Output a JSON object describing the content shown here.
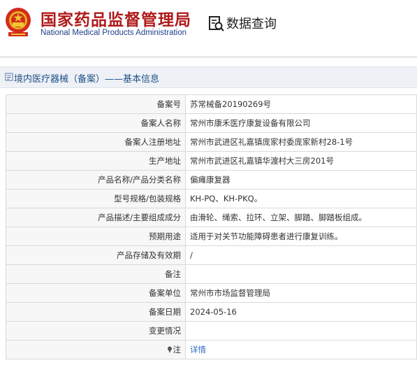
{
  "header": {
    "title_cn": "国家药品监督管理局",
    "title_en": "National Medical Products Administration",
    "search_label": "数据查询"
  },
  "section": {
    "title": "境内医疗器械（备案）——基本信息"
  },
  "rows": [
    {
      "label": "备案号",
      "value": "苏常械备20190269号"
    },
    {
      "label": "备案人名称",
      "value": "常州市康禾医疗康复设备有限公司"
    },
    {
      "label": "备案人注册地址",
      "value": "常州市武进区礼嘉镇庞家村委庞家新村28-1号"
    },
    {
      "label": "生产地址",
      "value": "常州市武进区礼嘉镇华渡村大三房201号"
    },
    {
      "label": "产品名称/产品分类名称",
      "value": "偏瘫康复器"
    },
    {
      "label": "型号规格/包装规格",
      "value": "KH-PQ、KH-PKQ。"
    },
    {
      "label": "产品描述/主要组成成分",
      "value": "由滑轮、绳索、拉环、立架、脚踏、脚踏板组成。"
    },
    {
      "label": "预期用途",
      "value": "适用于对关节功能障碍患者进行康复训练。"
    },
    {
      "label": "产品存储及有效期",
      "value": "/"
    },
    {
      "label": "备注",
      "value": ""
    },
    {
      "label": "备案单位",
      "value": "常州市市场监督管理局"
    },
    {
      "label": "备案日期",
      "value": "2024-05-16"
    },
    {
      "label": "变更情况",
      "value": ""
    }
  ],
  "note_row": {
    "label": "注",
    "link": "详情"
  },
  "colors": {
    "brand_red": "#b01a1a",
    "brand_blue": "#1d3f8c",
    "link": "#2a6bbf"
  }
}
